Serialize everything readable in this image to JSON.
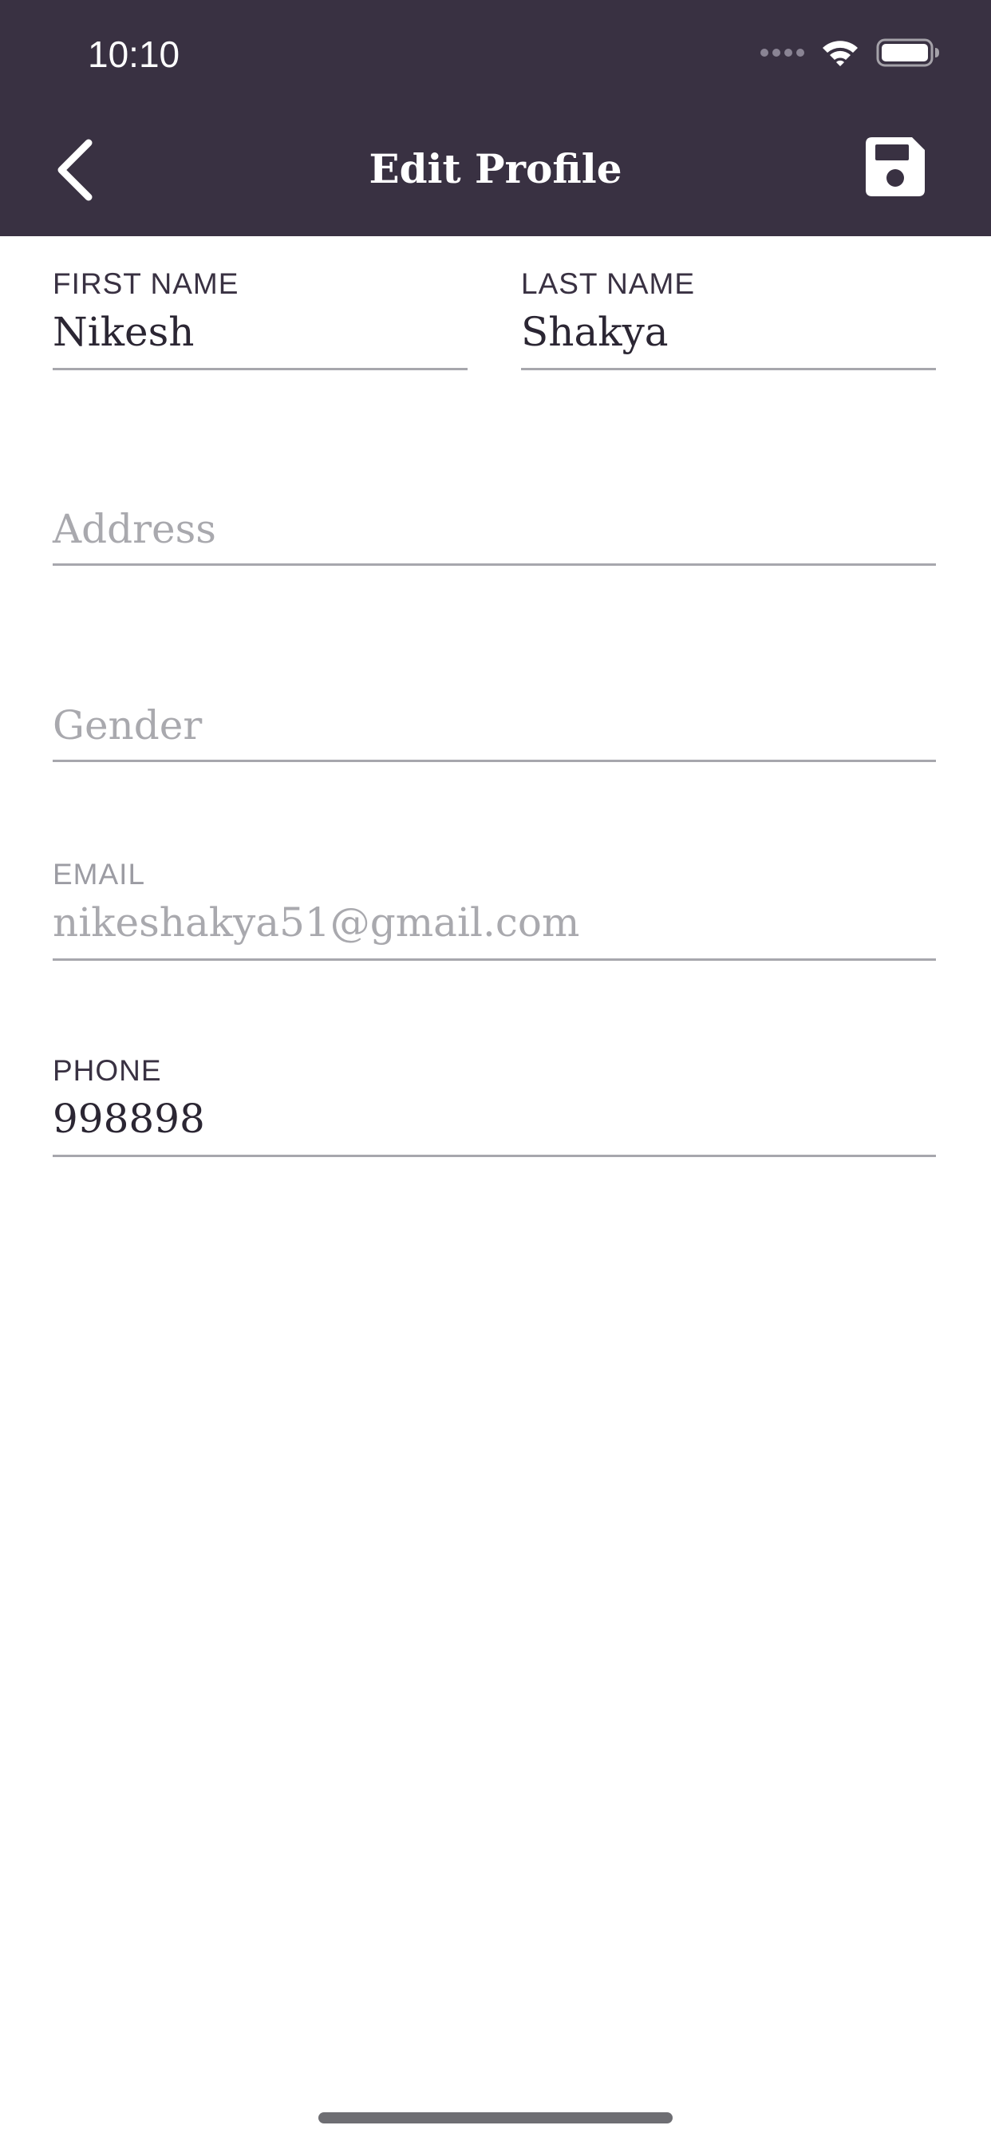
{
  "status_bar": {
    "time": "10:10",
    "icons": [
      "signal-icon",
      "wifi-icon",
      "battery-icon"
    ]
  },
  "header": {
    "title": "Edit Profile",
    "back_icon": "chevron-left-icon",
    "save_icon": "floppy-disk-icon",
    "background": "#393142"
  },
  "form": {
    "first_name": {
      "label": "FIRST NAME",
      "value": "Nikesh"
    },
    "last_name": {
      "label": "LAST NAME",
      "value": "Shakya"
    },
    "address": {
      "placeholder": "Address",
      "value": ""
    },
    "gender": {
      "placeholder": "Gender",
      "value": ""
    },
    "email": {
      "label": "EMAIL",
      "value": "nikeshakya51@gmail.com"
    },
    "phone": {
      "label": "PHONE",
      "value": "998898"
    }
  }
}
